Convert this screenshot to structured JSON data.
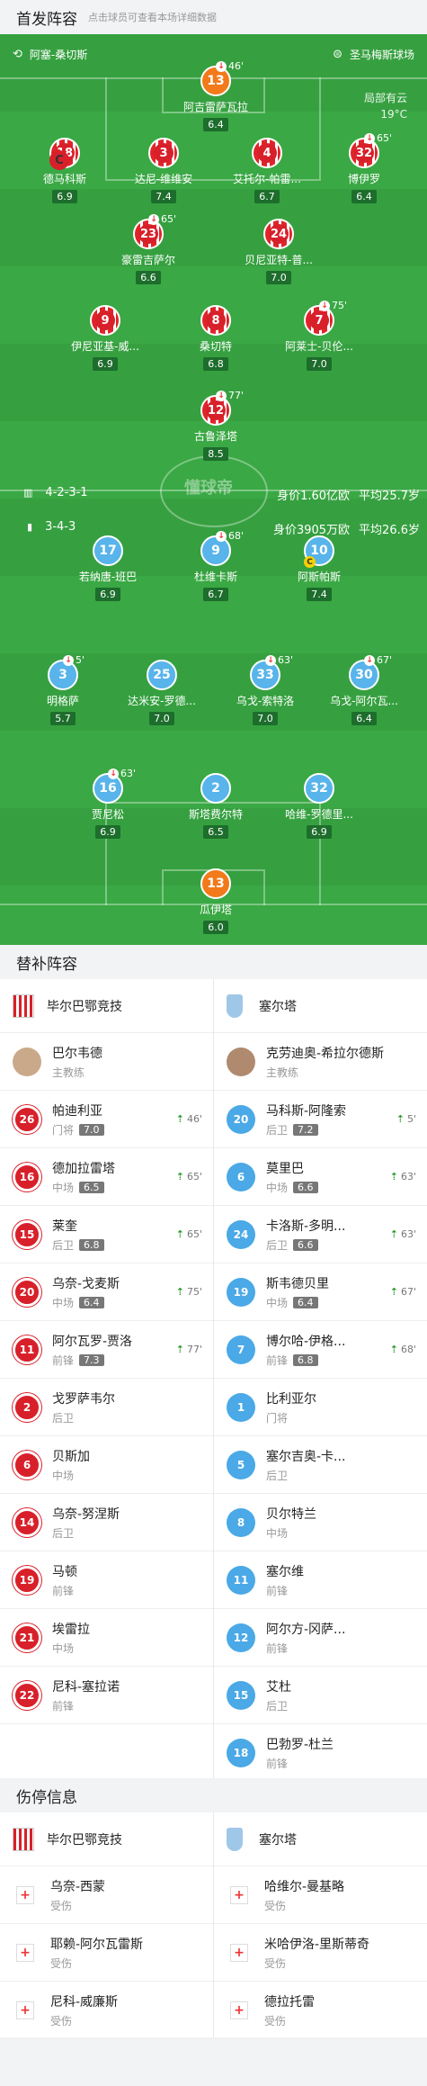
{
  "header": {
    "title": "首发阵容",
    "hint": "点击球员可查看本场详细数据"
  },
  "pitch": {
    "home_team": "阿塞-桑切斯",
    "venue": "圣马梅斯球场",
    "weather": "局部有云",
    "temp": "19°C",
    "watermark": "懂球帝",
    "home": {
      "formation": "4-2-3-1",
      "value": "身价1.60亿欧",
      "age": "平均25.7岁"
    },
    "away": {
      "formation": "3-4-3",
      "value": "身价3905万欧",
      "age": "平均26.6岁"
    },
    "players": [
      {
        "no": "13",
        "name": "阿吉雷萨瓦拉",
        "rating": "6.4",
        "ev": "46'",
        "kit": "orange"
      },
      {
        "no": "18",
        "name": "德马科斯",
        "rating": "6.9",
        "ev": "",
        "kit": "red",
        "captain": "C"
      },
      {
        "no": "3",
        "name": "达尼-维维安",
        "rating": "7.4",
        "ev": "",
        "kit": "red"
      },
      {
        "no": "4",
        "name": "艾托尔-帕雷...",
        "rating": "6.7",
        "ev": "",
        "kit": "red"
      },
      {
        "no": "32",
        "name": "博伊罗",
        "rating": "6.4",
        "ev": "65'",
        "kit": "red"
      },
      {
        "no": "23",
        "name": "豪雷吉萨尔",
        "rating": "6.6",
        "ev": "65'",
        "kit": "red"
      },
      {
        "no": "24",
        "name": "贝尼亚特-普...",
        "rating": "7.0",
        "ev": "",
        "kit": "red"
      },
      {
        "no": "9",
        "name": "伊尼亚基-威...",
        "rating": "6.9",
        "ev": "",
        "kit": "red"
      },
      {
        "no": "8",
        "name": "桑切特",
        "rating": "6.8",
        "ev": "",
        "kit": "red"
      },
      {
        "no": "7",
        "name": "阿莱士-贝伦...",
        "rating": "7.0",
        "ev": "75'",
        "kit": "red"
      },
      {
        "no": "12",
        "name": "古鲁泽塔",
        "rating": "8.5",
        "ev": "77'",
        "kit": "red"
      },
      {
        "no": "17",
        "name": "若纳唐-班巴",
        "rating": "6.9",
        "ev": "",
        "kit": "blue"
      },
      {
        "no": "9",
        "name": "杜维卡斯",
        "rating": "6.7",
        "ev": "68'",
        "kit": "blue"
      },
      {
        "no": "10",
        "name": "阿斯帕斯",
        "rating": "7.4",
        "ev": "",
        "kit": "blue",
        "captain": "C"
      },
      {
        "no": "3",
        "name": "明格萨",
        "rating": "5.7",
        "ev": "5'",
        "kit": "blue"
      },
      {
        "no": "25",
        "name": "达米安-罗德...",
        "rating": "7.0",
        "ev": "",
        "kit": "blue"
      },
      {
        "no": "33",
        "name": "乌戈-索特洛",
        "rating": "7.0",
        "ev": "63'",
        "kit": "blue"
      },
      {
        "no": "30",
        "name": "乌戈-阿尔瓦...",
        "rating": "6.4",
        "ev": "67'",
        "kit": "blue"
      },
      {
        "no": "16",
        "name": "贾尼松",
        "rating": "6.9",
        "ev": "63'",
        "kit": "blue"
      },
      {
        "no": "2",
        "name": "斯塔费尔特",
        "rating": "6.5",
        "ev": "",
        "kit": "blue"
      },
      {
        "no": "32",
        "name": "哈维-罗德里...",
        "rating": "6.9",
        "ev": "",
        "kit": "blue"
      },
      {
        "no": "13",
        "name": "瓜伊塔",
        "rating": "6.0",
        "ev": "",
        "kit": "orange"
      }
    ]
  },
  "subs": {
    "title": "替补阵容",
    "home_team": "毕尔巴鄂竞技",
    "away_team": "塞尔塔",
    "home_coach": "巴尔韦德",
    "away_coach": "克劳迪奥-希拉尔德斯",
    "coach_label": "主教练",
    "home": [
      {
        "no": "26",
        "name": "帕迪利亚",
        "pos": "门将",
        "rating": "7.0",
        "ev": "46'"
      },
      {
        "no": "16",
        "name": "德加拉雷塔",
        "pos": "中场",
        "rating": "6.5",
        "ev": "65'"
      },
      {
        "no": "15",
        "name": "莱奎",
        "pos": "后卫",
        "rating": "6.8",
        "ev": "65'"
      },
      {
        "no": "20",
        "name": "乌奈-戈麦斯",
        "pos": "中场",
        "rating": "6.4",
        "ev": "75'"
      },
      {
        "no": "11",
        "name": "阿尔瓦罗-贾洛",
        "pos": "前锋",
        "rating": "7.3",
        "ev": "77'"
      },
      {
        "no": "2",
        "name": "戈罗萨韦尔",
        "pos": "后卫",
        "rating": "",
        "ev": ""
      },
      {
        "no": "6",
        "name": "贝斯加",
        "pos": "中场",
        "rating": "",
        "ev": ""
      },
      {
        "no": "14",
        "name": "乌奈-努涅斯",
        "pos": "后卫",
        "rating": "",
        "ev": ""
      },
      {
        "no": "19",
        "name": "马顿",
        "pos": "前锋",
        "rating": "",
        "ev": ""
      },
      {
        "no": "21",
        "name": "埃雷拉",
        "pos": "中场",
        "rating": "",
        "ev": ""
      },
      {
        "no": "22",
        "name": "尼科-塞拉诺",
        "pos": "前锋",
        "rating": "",
        "ev": ""
      }
    ],
    "away": [
      {
        "no": "20",
        "name": "马科斯-阿隆索",
        "pos": "后卫",
        "rating": "7.2",
        "ev": "5'"
      },
      {
        "no": "6",
        "name": "莫里巴",
        "pos": "中场",
        "rating": "6.6",
        "ev": "63'"
      },
      {
        "no": "24",
        "name": "卡洛斯-多明...",
        "pos": "后卫",
        "rating": "6.6",
        "ev": "63'"
      },
      {
        "no": "19",
        "name": "斯韦德贝里",
        "pos": "中场",
        "rating": "6.4",
        "ev": "67'"
      },
      {
        "no": "7",
        "name": "博尔哈-伊格...",
        "pos": "前锋",
        "rating": "6.8",
        "ev": "68'"
      },
      {
        "no": "1",
        "name": "比利亚尔",
        "pos": "门将",
        "rating": "",
        "ev": ""
      },
      {
        "no": "5",
        "name": "塞尔吉奥-卡...",
        "pos": "后卫",
        "rating": "",
        "ev": ""
      },
      {
        "no": "8",
        "name": "贝尔特兰",
        "pos": "中场",
        "rating": "",
        "ev": ""
      },
      {
        "no": "11",
        "name": "塞尔维",
        "pos": "前锋",
        "rating": "",
        "ev": ""
      },
      {
        "no": "12",
        "name": "阿尔方-冈萨...",
        "pos": "前锋",
        "rating": "",
        "ev": ""
      },
      {
        "no": "15",
        "name": "艾杜",
        "pos": "后卫",
        "rating": "",
        "ev": ""
      },
      {
        "no": "18",
        "name": "巴勃罗-杜兰",
        "pos": "前锋",
        "rating": "",
        "ev": ""
      }
    ]
  },
  "injuries": {
    "title": "伤停信息",
    "home_team": "毕尔巴鄂竞技",
    "away_team": "塞尔塔",
    "home": [
      {
        "name": "乌奈-西蒙",
        "status": "受伤"
      },
      {
        "name": "耶赖-阿尔瓦雷斯",
        "status": "受伤"
      },
      {
        "name": "尼科-威廉斯",
        "status": "受伤"
      }
    ],
    "away": [
      {
        "name": "哈维尔-曼基略",
        "status": "受伤"
      },
      {
        "name": "米哈伊洛-里斯蒂奇",
        "status": "受伤"
      },
      {
        "name": "德拉托雷",
        "status": "受伤"
      }
    ]
  }
}
